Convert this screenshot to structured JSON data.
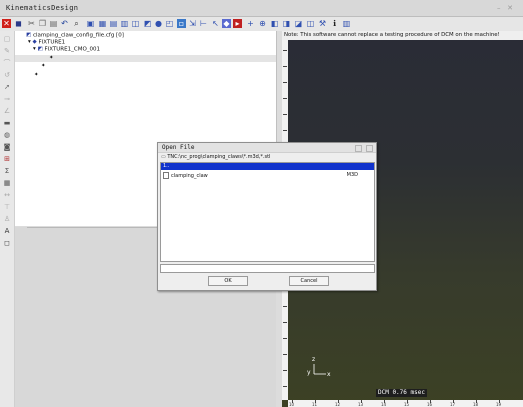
{
  "window": {
    "title": "KinematicsDesign",
    "controls": [
      "–",
      "✕"
    ]
  },
  "toolbar": {
    "icons": [
      "close-app-icon",
      "save-icon",
      "cut-icon",
      "copy-icon",
      "paste-icon",
      "undo-icon",
      "find-icon",
      "view-icon",
      "grid-icon",
      "list-icon",
      "table-icon",
      "layers-icon",
      "shape-icon",
      "circle-icon",
      "frame-icon",
      "highlight-icon",
      "move-icon",
      "axis-icon",
      "select-icon",
      "collision-icon",
      "transform-icon",
      "plus-icon",
      "tool-icon",
      "component-icon",
      "part-icon",
      "fixture-icon",
      "view3d-icon",
      "settings-icon",
      "info-icon",
      "stats-icon"
    ]
  },
  "tree": {
    "root_label": "clamping_claw_config_file.cfg  [0]",
    "fixture_label": "FIXTURE1",
    "fixture_cmo_label": "FIXTURE1_CMO_001"
  },
  "viewport": {
    "note": "Note: This software cannot replace a testing procedure of DCM on the machine!",
    "axis_z": "z",
    "axis_y": "y",
    "axis_x": "x",
    "dcm_status": "DCM 0.76 msec",
    "ruler_labels": [
      "10",
      "11",
      "12",
      "13",
      "14",
      "15",
      "16",
      "17",
      "18",
      "19"
    ]
  },
  "dialog": {
    "title": "Open File",
    "path": "TNC:\\nc_prog\\clamping_claws\\*.m3d,*.stl",
    "selected_entry": "1..",
    "files": [
      {
        "name": "clamping_claw",
        "type": "M3D"
      }
    ],
    "filename_value": "",
    "ok_label": "OK",
    "cancel_label": "Cancel"
  },
  "colors": {
    "selection": "#1133cc",
    "viewport_top": "#2a2c36",
    "viewport_bottom": "#3c4124"
  }
}
